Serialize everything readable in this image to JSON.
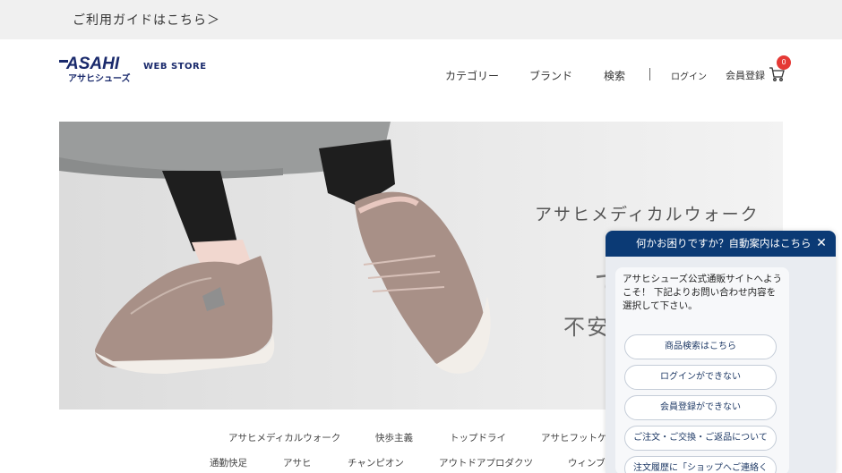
{
  "topbar": {
    "guide_link": "ご利用ガイドはこちら＞"
  },
  "header": {
    "logo_text": "ASAHI",
    "logo_sub": "アサヒシューズ",
    "store_label": "WEB STORE",
    "nav": {
      "category": "カテゴリー",
      "brand": "ブランド",
      "search": "検索"
    },
    "login": "ログイン",
    "register": "会員登録",
    "cart_count": "0"
  },
  "hero": {
    "title": "アサヒメディカルウォーク",
    "big_char": "て",
    "sub_text": "不安"
  },
  "categories": {
    "row1": [
      "アサヒメディカルウォーク",
      "快歩主義",
      "トップドライ",
      "アサヒフットケ"
    ],
    "row2": [
      "通勤快足",
      "アサヒ",
      "チャンピオン",
      "アウトドアプロダクツ",
      "ウィンブ"
    ]
  },
  "chat": {
    "header": "何かお困りですか？自動案内はこちら",
    "close": "✕",
    "message": "アサヒシューズ公式通販サイトへようこそ！ 下記よりお問い合わせ内容を選択して下さい。",
    "buttons": [
      "商品検索はこちら",
      "ログインができない",
      "会員登録ができない",
      "ご注文・ご交換・ご返品について",
      "注文履歴に「ショップへご連絡く"
    ]
  },
  "colors": {
    "brand_navy": "#1a2a6c",
    "chat_header": "#0b3a75",
    "badge": "#e53935"
  }
}
